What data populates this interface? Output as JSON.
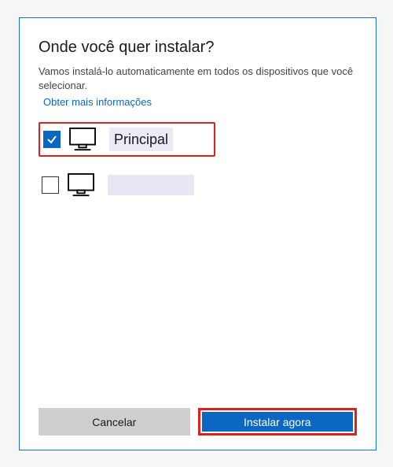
{
  "dialog": {
    "title": "Onde você quer instalar?",
    "description": "Vamos instalá-lo automaticamente em todos os dispositivos que você selecionar.",
    "more_info_link": "Obter mais informações"
  },
  "devices": [
    {
      "name": "Principal",
      "checked": true,
      "highlighted": true
    },
    {
      "name": "",
      "checked": false,
      "highlighted": false
    }
  ],
  "buttons": {
    "cancel": "Cancelar",
    "install": "Instalar agora"
  }
}
